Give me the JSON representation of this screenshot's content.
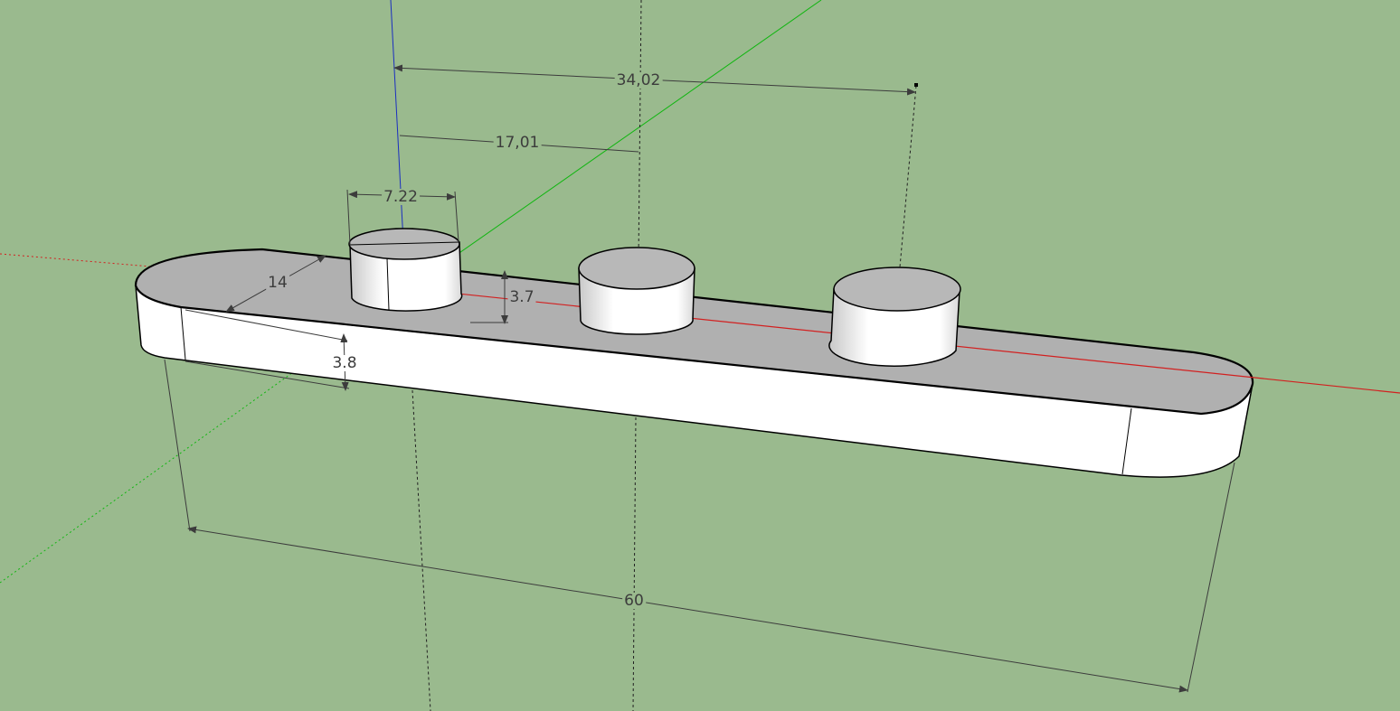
{
  "viewport": {
    "background": "#9aba8e",
    "axis_colors": {
      "red": "#d22020",
      "green": "#11b611",
      "blue": "#1a2ec0"
    }
  },
  "model": {
    "top_color": "#b0b0b0",
    "side_color": "#ffffff",
    "edge_color": "#000000"
  },
  "dimensions": {
    "top_span": "34,02",
    "half_span": "17,01",
    "peg_diameter": "7.22",
    "plate_width": "14",
    "peg_height": "3.7",
    "plate_thickness": "3.8",
    "plate_length": "60"
  }
}
